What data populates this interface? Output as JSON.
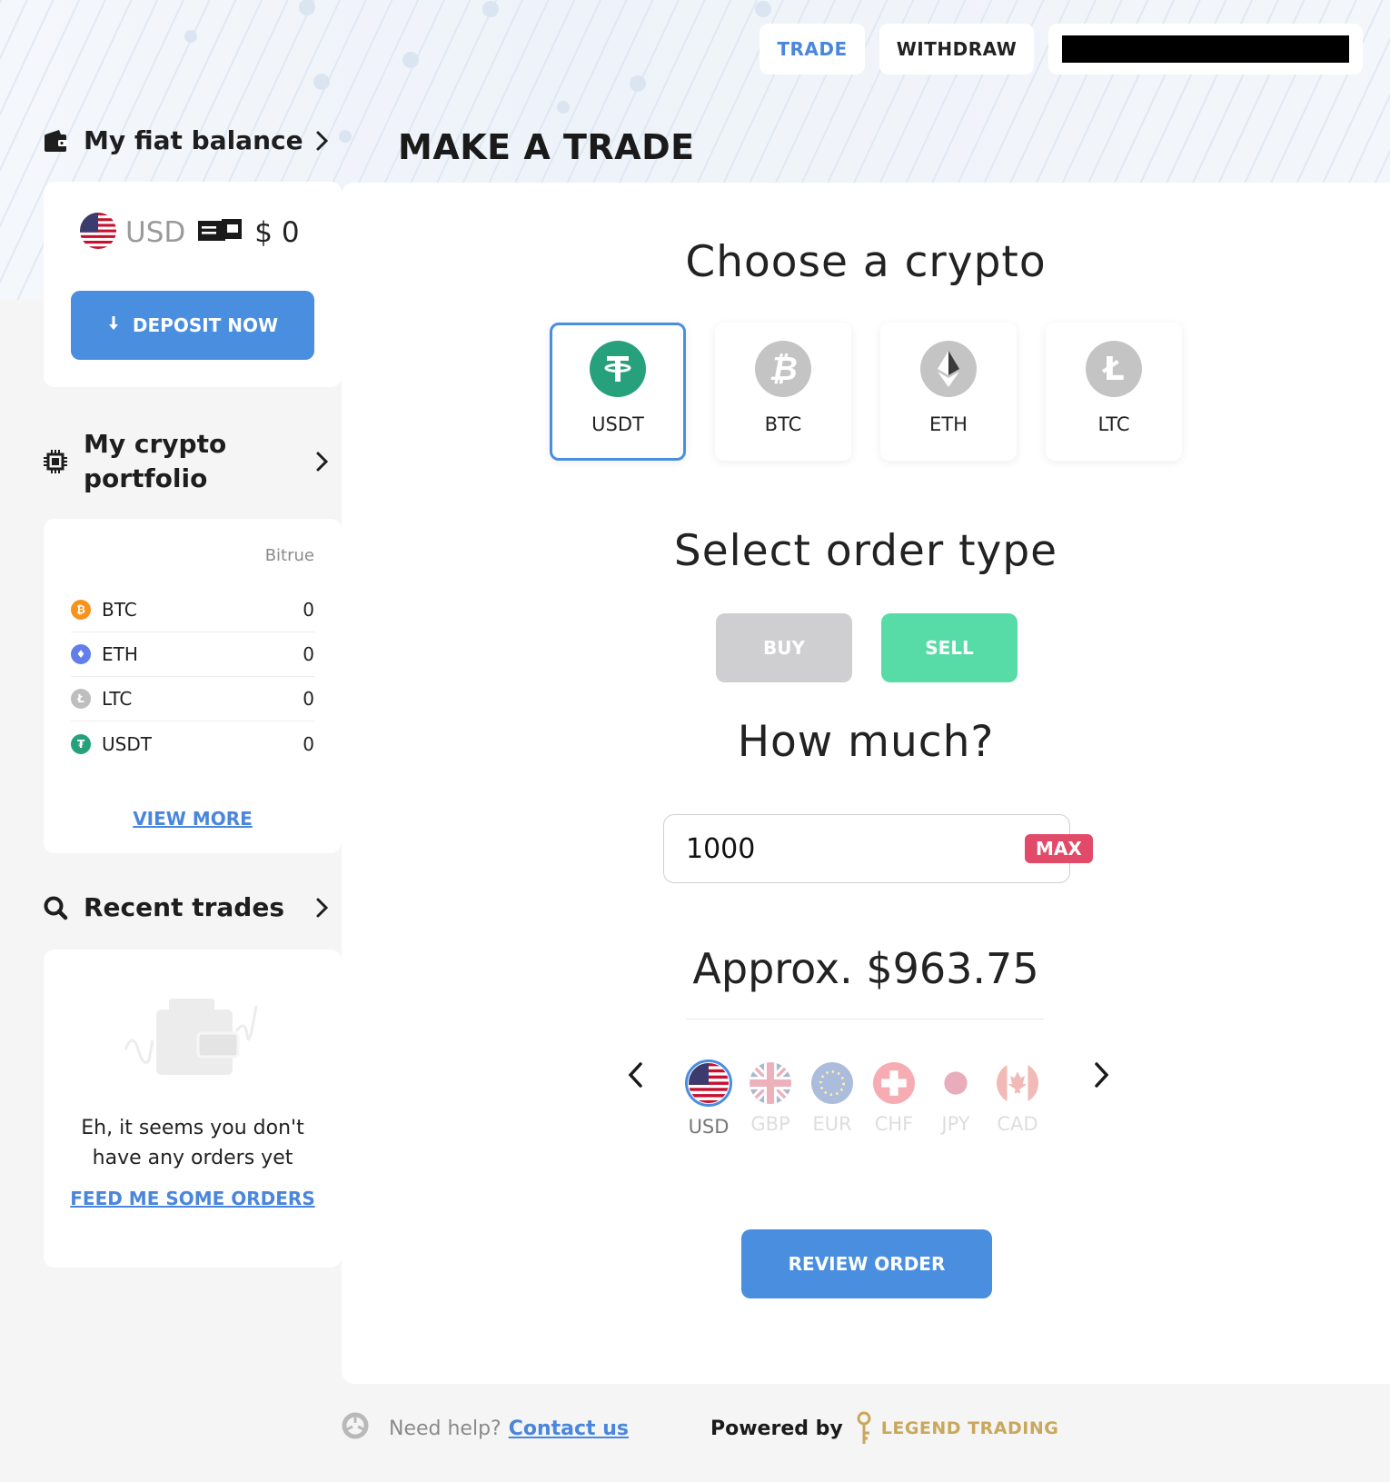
{
  "nav": {
    "trade": "TRADE",
    "withdraw": "WITHDRAW"
  },
  "sidebar": {
    "fiat": {
      "title": "My fiat balance",
      "currency": "USD",
      "amount": "$ 0",
      "deposit_label": "DEPOSIT NOW"
    },
    "portfolio": {
      "title_line1": "My crypto",
      "title_line2": "portfolio",
      "exchange": "Bitrue",
      "items": [
        {
          "symbol": "BTC",
          "amount": "0",
          "color": "#f7931a"
        },
        {
          "symbol": "ETH",
          "amount": "0",
          "color": "#627eea"
        },
        {
          "symbol": "LTC",
          "amount": "0",
          "color": "#bebebe"
        },
        {
          "symbol": "USDT",
          "amount": "0",
          "color": "#26a17b"
        }
      ],
      "view_more": "VIEW MORE"
    },
    "recent": {
      "title": "Recent trades",
      "empty_line1": "Eh, it seems you don't",
      "empty_line2": "have any orders yet",
      "feed_link": "FEED ME SOME ORDERS"
    }
  },
  "main": {
    "page_title": "MAKE A TRADE",
    "choose_title": "Choose a crypto",
    "cryptos": [
      {
        "label": "USDT",
        "icon": "tether-icon",
        "selected": true,
        "color": "#26a17b"
      },
      {
        "label": "BTC",
        "icon": "bitcoin-icon",
        "selected": false,
        "color": "#c4c4c4"
      },
      {
        "label": "ETH",
        "icon": "ethereum-icon",
        "selected": false,
        "color": "#c4c4c4"
      },
      {
        "label": "LTC",
        "icon": "litecoin-icon",
        "selected": false,
        "color": "#c4c4c4"
      }
    ],
    "order_title": "Select order type",
    "buy_label": "BUY",
    "sell_label": "SELL",
    "amount_title": "How much?",
    "amount_value": "1000",
    "max_label": "MAX",
    "approx": "Approx. $963.75",
    "currencies": [
      "USD",
      "GBP",
      "EUR",
      "CHF",
      "JPY",
      "CAD"
    ],
    "selected_currency": "USD",
    "review_label": "REVIEW ORDER"
  },
  "footer": {
    "help": "Need help?",
    "contact": "Contact us",
    "powered": "Powered by",
    "brand": "LEGEND TRADING"
  },
  "colors": {
    "accent": "#4a8ee0",
    "sell": "#57dca7",
    "buy_disabled": "#cfcfd1",
    "max": "#e14a68",
    "brand_gold": "#c9a85c"
  }
}
